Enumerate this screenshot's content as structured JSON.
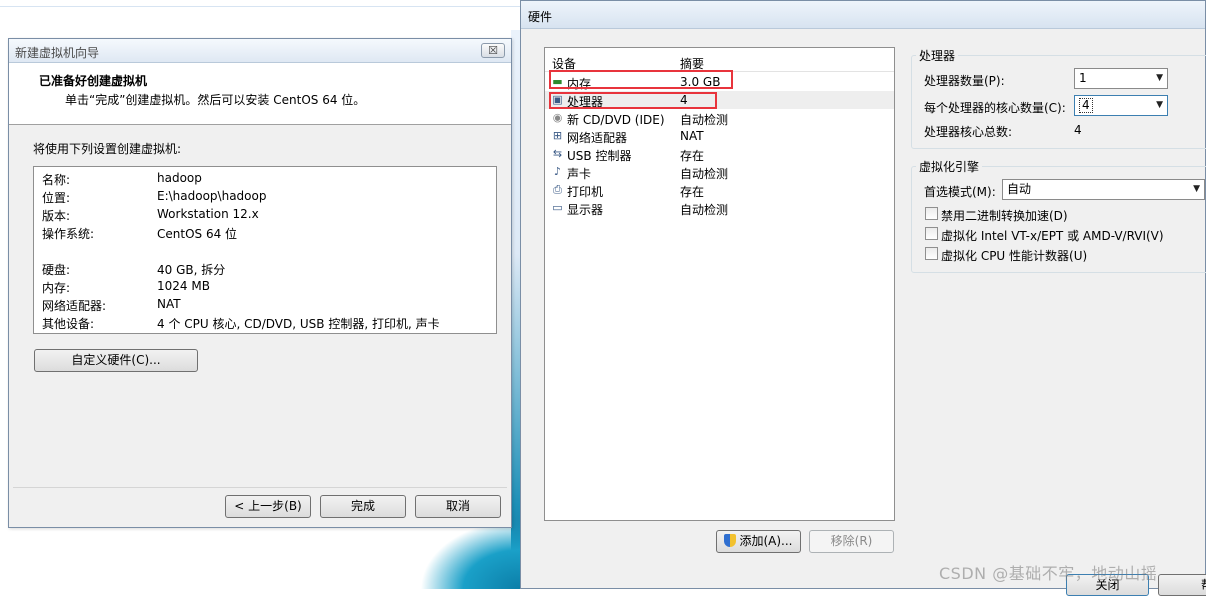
{
  "wizard": {
    "title": "新建虚拟机向导",
    "close_label": "☒",
    "heading": "已准备好创建虚拟机",
    "subheading": "单击“完成”创建虚拟机。然后可以安装 CentOS 64 位。",
    "intro": "将使用下列设置创建虚拟机:",
    "summary": [
      {
        "key": "名称:",
        "value": "hadoop"
      },
      {
        "key": "位置:",
        "value": "E:\\hadoop\\hadoop"
      },
      {
        "key": "版本:",
        "value": "Workstation 12.x"
      },
      {
        "key": "操作系统:",
        "value": "CentOS 64 位"
      },
      {
        "key": "硬盘:",
        "value": "40 GB, 拆分"
      },
      {
        "key": "内存:",
        "value": "1024 MB"
      },
      {
        "key": "网络适配器:",
        "value": "NAT"
      },
      {
        "key": "其他设备:",
        "value": "4 个 CPU 核心, CD/DVD, USB 控制器, 打印机, 声卡"
      }
    ],
    "customize_button": "自定义硬件(C)...",
    "back_button": "< 上一步(B)",
    "finish_button": "完成",
    "cancel_button": "取消"
  },
  "hardware": {
    "title": "硬件",
    "columns": {
      "device": "设备",
      "summary": "摘要"
    },
    "devices": [
      {
        "icon": "memory-icon",
        "glyph": "▬",
        "name": "内存",
        "summary": "3.0 GB"
      },
      {
        "icon": "processor-icon",
        "glyph": "▣",
        "name": "处理器",
        "summary": "4"
      },
      {
        "icon": "cd-dvd-icon",
        "glyph": "◉",
        "name": "新 CD/DVD (IDE)",
        "summary": "自动检测"
      },
      {
        "icon": "network-adapter-icon",
        "glyph": "⊞",
        "name": "网络适配器",
        "summary": "NAT"
      },
      {
        "icon": "usb-icon",
        "glyph": "⇆",
        "name": "USB 控制器",
        "summary": "存在"
      },
      {
        "icon": "sound-card-icon",
        "glyph": "♪",
        "name": "声卡",
        "summary": "自动检测"
      },
      {
        "icon": "printer-icon",
        "glyph": "⎙",
        "name": "打印机",
        "summary": "存在"
      },
      {
        "icon": "display-icon",
        "glyph": "▭",
        "name": "显示器",
        "summary": "自动检测"
      }
    ],
    "add_button": "添加(A)...",
    "remove_button": "移除(R)",
    "close_button": "关闭",
    "help_button": "帮助",
    "processor_group": {
      "label": "处理器",
      "count_label": "处理器数量(P):",
      "count_value": "1",
      "cores_label": "每个处理器的核心数量(C):",
      "cores_value": "4",
      "total_label": "处理器核心总数:",
      "total_value": "4"
    },
    "virtualization_group": {
      "label": "虚拟化引擎",
      "mode_label": "首选模式(M):",
      "mode_value": "自动",
      "options": [
        "禁用二进制转换加速(D)",
        "虚拟化 Intel VT-x/EPT 或 AMD-V/RVI(V)",
        "虚拟化 CPU 性能计数器(U)"
      ]
    }
  },
  "watermark": "CSDN @基础不牢，地动山摇",
  "highlight_color": "#e8343c"
}
